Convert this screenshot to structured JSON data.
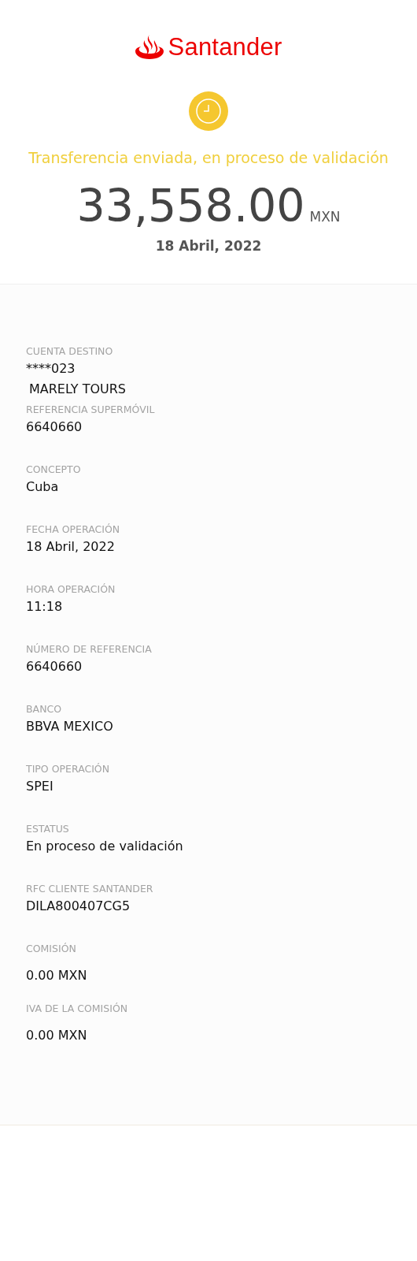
{
  "header": {
    "brand": "Santander",
    "status": "Transferencia enviada, en proceso de validación",
    "amount": "33,558.00",
    "currency": "MXN",
    "date": "18 Abril, 2022"
  },
  "details": [
    {
      "kind": "account",
      "label": "CUENTA DESTINO",
      "values": [
        "****023",
        "MARELY TOURS"
      ]
    },
    {
      "kind": "text",
      "label": "REFERENCIA SUPERMÓVIL",
      "values": [
        "6640660"
      ]
    },
    {
      "kind": "text",
      "label": "CONCEPTO",
      "values": [
        "Cuba"
      ]
    },
    {
      "kind": "text",
      "label": "FECHA OPERACIÓN",
      "values": [
        "18 Abril, 2022"
      ]
    },
    {
      "kind": "text",
      "label": "HORA OPERACIÓN",
      "values": [
        "11:18"
      ]
    },
    {
      "kind": "text",
      "label": "NÚMERO DE REFERENCIA",
      "values": [
        "6640660"
      ]
    },
    {
      "kind": "text",
      "label": "BANCO",
      "values": [
        "BBVA MEXICO"
      ]
    },
    {
      "kind": "text",
      "label": "TIPO OPERACIÓN",
      "values": [
        "SPEI"
      ]
    },
    {
      "kind": "text",
      "label": "ESTATUS",
      "values": [
        "En proceso de validación"
      ]
    },
    {
      "kind": "text",
      "label": "RFC CLIENTE SANTANDER",
      "values": [
        "DILA800407CG5"
      ]
    },
    {
      "kind": "amount",
      "label": "COMISIÓN",
      "values": [
        "0.00 MXN"
      ]
    },
    {
      "kind": "amount",
      "label": "IVA DE LA COMISIÓN",
      "values": [
        "0.00 MXN"
      ]
    }
  ]
}
